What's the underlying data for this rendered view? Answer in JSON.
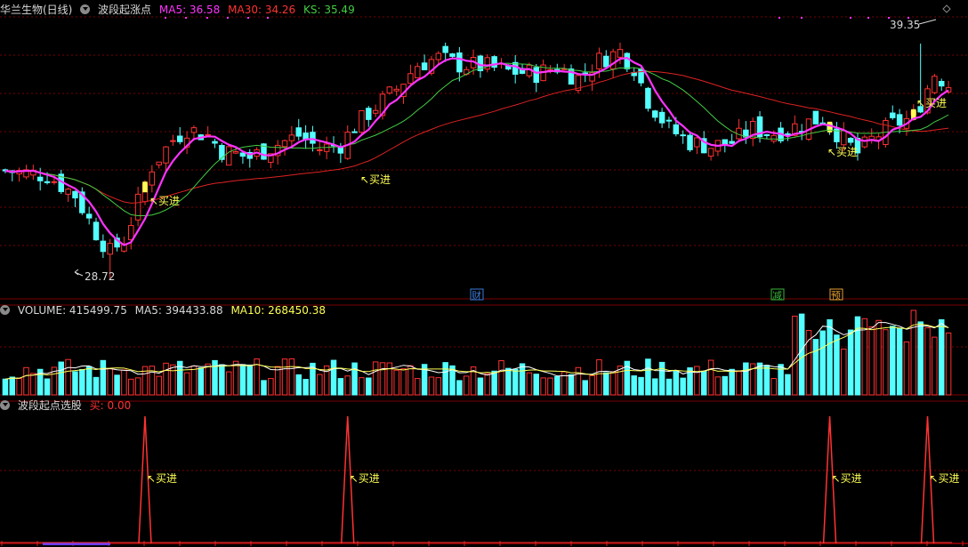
{
  "price_panel": {
    "stock_name": "华兰生物(日线)",
    "indicator_name": "波段起涨点",
    "ma5_label": "MA5: 36.58",
    "ma30_label": "MA30: 34.26",
    "ks_label": "KS: 35.49",
    "high_mark": "39.35",
    "low_mark": "28.72",
    "buy_label": "买进",
    "events": [
      "财",
      "减",
      "预"
    ]
  },
  "volume_panel": {
    "volume_label": "VOLUME: 415499.75",
    "ma5_label": "MA5: 394433.88",
    "ma10_label": "MA10: 268450.38"
  },
  "signal_panel": {
    "indicator_name": "波段起点选股",
    "buy_value_label": "买: 0.00",
    "buy_label": "买进"
  },
  "colors": {
    "up": "#ff3232",
    "down": "#54ffff",
    "ma5": "#ff33ff",
    "ma10": "#ffff54",
    "ma30": "#dd2222",
    "ks": "#44cc44",
    "grid": "#7a0000",
    "text": "#d8d8d8",
    "buy": "#ffff54",
    "event_cai": "#3a7ad8",
    "event_jian": "#3ab43a",
    "event_yu": "#e8a030"
  },
  "chart_data": [
    {
      "type": "candlestick",
      "title": "华兰生物(日线)",
      "ylim": [
        27.8,
        40.6
      ],
      "grid": true,
      "high_annotation": 39.35,
      "low_annotation": 28.72,
      "buy_signal_indices": [
        20,
        49,
        118,
        132
      ],
      "event_markers": [
        {
          "index": 67,
          "label": "财"
        },
        {
          "index": 110,
          "label": "减"
        },
        {
          "index": 118,
          "label": "预"
        }
      ],
      "series": [
        {
          "name": "MA5",
          "value": 36.58
        },
        {
          "name": "MA30",
          "value": 34.26
        },
        {
          "name": "KS",
          "value": 35.49
        }
      ]
    },
    {
      "type": "bar",
      "title": "VOLUME",
      "last_values": {
        "VOLUME": 415499.75,
        "MA5": 394433.88,
        "MA10": 268450.38
      }
    },
    {
      "type": "line",
      "title": "波段起点选股",
      "series": [
        {
          "name": "买",
          "last_value": 0.0
        }
      ],
      "signal_indices": [
        20,
        49,
        118,
        132
      ]
    }
  ]
}
